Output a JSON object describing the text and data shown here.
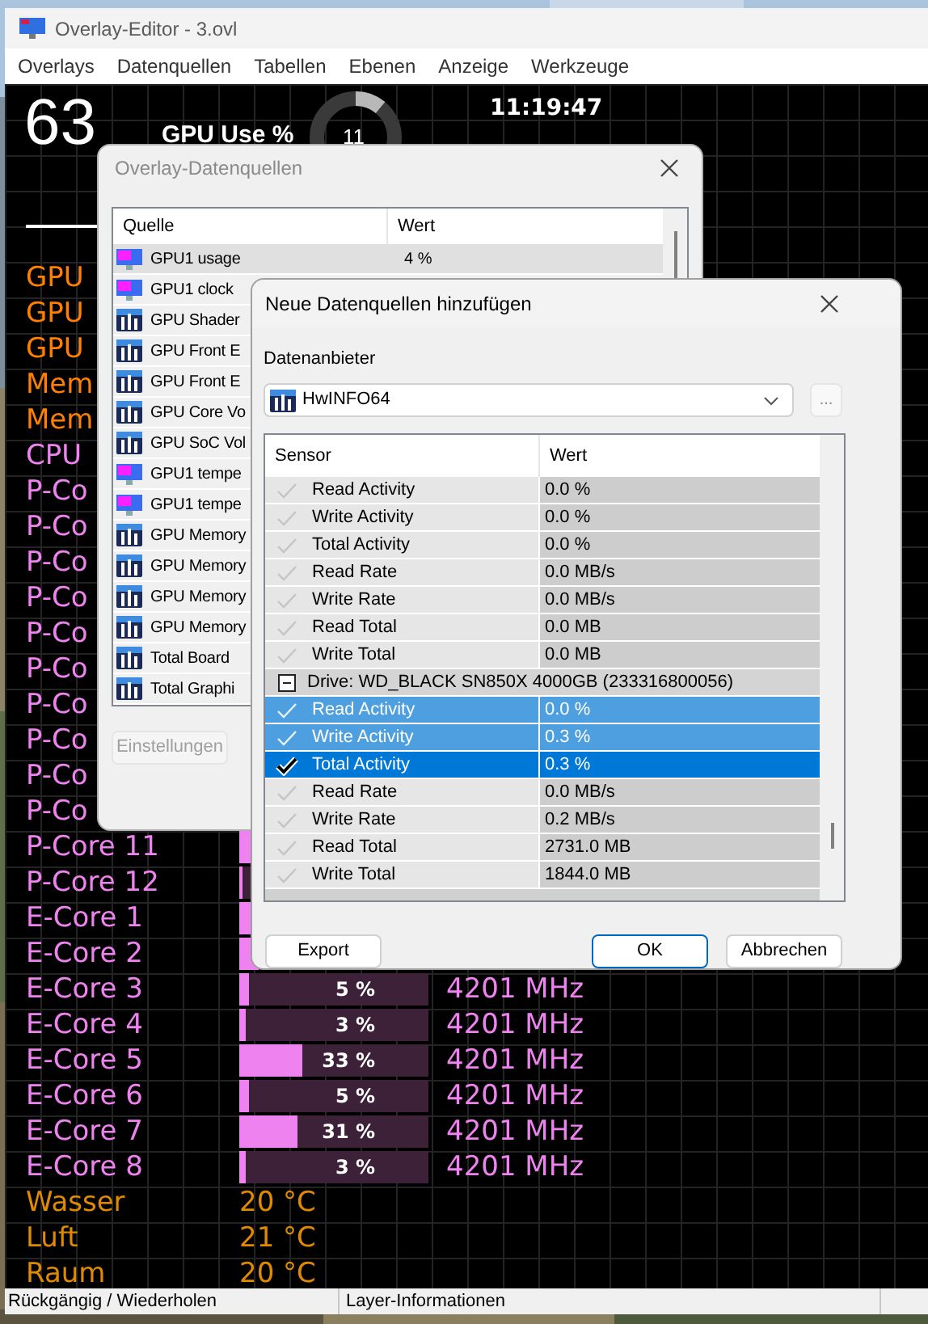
{
  "window": {
    "title": "Overlay-Editor - 3.ovl"
  },
  "menu": [
    "Overlays",
    "Datenquellen",
    "Tabellen",
    "Ebenen",
    "Anzeige",
    "Werkzeuge"
  ],
  "overlay": {
    "big_number": "63",
    "gpu_label": "GPU Use %",
    "gauge": {
      "value": "11",
      "level": 0.11
    },
    "clock": "11:19:47",
    "rows": [
      {
        "kind": "label",
        "label": "GPU",
        "color": "#ff8000"
      },
      {
        "kind": "label",
        "label": "GPU",
        "color": "#ff8000"
      },
      {
        "kind": "label",
        "label": "GPU",
        "color": "#ff8000"
      },
      {
        "kind": "label",
        "label": "Mem",
        "color": "#ff8000"
      },
      {
        "kind": "label",
        "label": "Mem",
        "color": "#ff8000"
      },
      {
        "kind": "label",
        "label": "CPU",
        "color": "#ee82ee"
      },
      {
        "kind": "label",
        "label": "P-Co",
        "color": "#ee82ee"
      },
      {
        "kind": "label",
        "label": "P-Co",
        "color": "#ee82ee"
      },
      {
        "kind": "label",
        "label": "P-Co",
        "color": "#ee82ee"
      },
      {
        "kind": "label",
        "label": "P-Co",
        "color": "#ee82ee"
      },
      {
        "kind": "label",
        "label": "P-Co",
        "color": "#ee82ee"
      },
      {
        "kind": "label",
        "label": "P-Co",
        "color": "#ee82ee"
      },
      {
        "kind": "label",
        "label": "P-Co",
        "color": "#ee82ee"
      },
      {
        "kind": "label",
        "label": "P-Co",
        "color": "#ee82ee"
      },
      {
        "kind": "label",
        "label": "P-Co",
        "color": "#ee82ee"
      },
      {
        "kind": "label",
        "label": "P-Co",
        "color": "#ee82ee"
      },
      {
        "kind": "bar",
        "label": "P-Core 11",
        "color": "#ee82ee",
        "level": 0.1
      },
      {
        "kind": "bar",
        "label": "P-Core 12",
        "color": "#ee82ee",
        "level": 0.02
      },
      {
        "kind": "bar",
        "label": "E-Core 1",
        "color": "#ee82ee",
        "level": 0.1
      },
      {
        "kind": "bar",
        "label": "E-Core 2",
        "color": "#ee82ee",
        "level": 0.1
      },
      {
        "kind": "bar",
        "label": "E-Core 3",
        "color": "#ee82ee",
        "level": 0.05,
        "value": "5 %",
        "frequency": "4201 MHz"
      },
      {
        "kind": "bar",
        "label": "E-Core 4",
        "color": "#ee82ee",
        "level": 0.03,
        "value": "3 %",
        "frequency": "4201 MHz"
      },
      {
        "kind": "bar",
        "label": "E-Core 5",
        "color": "#ee82ee",
        "level": 0.33,
        "value": "33 %",
        "frequency": "4201 MHz"
      },
      {
        "kind": "bar",
        "label": "E-Core 6",
        "color": "#ee82ee",
        "level": 0.05,
        "value": "5 %",
        "frequency": "4201 MHz"
      },
      {
        "kind": "bar",
        "label": "E-Core 7",
        "color": "#ee82ee",
        "level": 0.31,
        "value": "31 %",
        "frequency": "4201 MHz"
      },
      {
        "kind": "bar",
        "label": "E-Core 8",
        "color": "#ee82ee",
        "level": 0.03,
        "value": "3 %",
        "frequency": "4201 MHz"
      },
      {
        "kind": "reading",
        "label": "Wasser",
        "color": "#e08a00",
        "value": "20 °C"
      },
      {
        "kind": "reading",
        "label": "Luft",
        "color": "#e08a00",
        "value": "21 °C"
      },
      {
        "kind": "reading",
        "label": "Raum",
        "color": "#e08a00",
        "value": "20 °C"
      }
    ]
  },
  "sources_dialog": {
    "title": "Overlay-Datenquellen",
    "columns": [
      "Quelle",
      "Wert"
    ],
    "rows": [
      {
        "kind": "monitor",
        "name": "GPU1 usage",
        "value": "4 %",
        "selected": true
      },
      {
        "kind": "monitor",
        "name": "GPU1 clock",
        "selected": false
      },
      {
        "kind": "bars",
        "name": "GPU Shader",
        "selected": false
      },
      {
        "kind": "bars",
        "name": "GPU Front E",
        "selected": false
      },
      {
        "kind": "bars",
        "name": "GPU Front E",
        "selected": false
      },
      {
        "kind": "bars",
        "name": "GPU Core Vo",
        "selected": false
      },
      {
        "kind": "bars",
        "name": "GPU SoC Vol",
        "selected": false
      },
      {
        "kind": "monitor",
        "name": "GPU1 tempe",
        "selected": false
      },
      {
        "kind": "monitor",
        "name": "GPU1 tempe",
        "selected": false
      },
      {
        "kind": "bars",
        "name": "GPU Memory",
        "selected": false
      },
      {
        "kind": "bars",
        "name": "GPU Memory",
        "selected": false
      },
      {
        "kind": "bars",
        "name": "GPU Memory",
        "selected": false
      },
      {
        "kind": "bars",
        "name": "GPU Memory",
        "selected": false
      },
      {
        "kind": "bars",
        "name": "Total Board",
        "selected": false
      },
      {
        "kind": "bars",
        "name": "Total Graphi",
        "selected": false
      }
    ],
    "settings_button": {
      "label": "Einstellungen",
      "disabled": true
    }
  },
  "add_dialog": {
    "title": "Neue Datenquellen hinzufügen",
    "provider_label": "Datenanbieter",
    "provider": "HwINFO64",
    "more_button": "...",
    "columns": [
      "Sensor",
      "Wert"
    ],
    "rows": [
      {
        "kind": "sensor",
        "name": "Read Activity",
        "value": "0.0 %",
        "checked": false,
        "selected": false,
        "focused": false
      },
      {
        "kind": "sensor",
        "name": "Write Activity",
        "value": "0.0 %",
        "checked": false,
        "selected": false,
        "focused": false
      },
      {
        "kind": "sensor",
        "name": "Total Activity",
        "value": "0.0 %",
        "checked": false,
        "selected": false,
        "focused": false
      },
      {
        "kind": "sensor",
        "name": "Read Rate",
        "value": "0.0 MB/s",
        "checked": false,
        "selected": false,
        "focused": false
      },
      {
        "kind": "sensor",
        "name": "Write Rate",
        "value": "0.0 MB/s",
        "checked": false,
        "selected": false,
        "focused": false
      },
      {
        "kind": "sensor",
        "name": "Read Total",
        "value": "0.0 MB",
        "checked": false,
        "selected": false,
        "focused": false
      },
      {
        "kind": "sensor",
        "name": "Write Total",
        "value": "0.0 MB",
        "checked": false,
        "selected": false,
        "focused": false
      },
      {
        "kind": "group",
        "name": "Drive: WD_BLACK SN850X 4000GB (233316800056)",
        "expanded": true
      },
      {
        "kind": "sensor",
        "name": "Read Activity",
        "value": "0.0 %",
        "checked": false,
        "selected": true,
        "focused": false
      },
      {
        "kind": "sensor",
        "name": "Write Activity",
        "value": "0.3 %",
        "checked": false,
        "selected": true,
        "focused": false
      },
      {
        "kind": "sensor",
        "name": "Total Activity",
        "value": "0.3 %",
        "checked": true,
        "selected": true,
        "focused": true
      },
      {
        "kind": "sensor",
        "name": "Read Rate",
        "value": "0.0 MB/s",
        "checked": false,
        "selected": false,
        "focused": false
      },
      {
        "kind": "sensor",
        "name": "Write Rate",
        "value": "0.2 MB/s",
        "checked": false,
        "selected": false,
        "focused": false
      },
      {
        "kind": "sensor",
        "name": "Read Total",
        "value": "2731.0 MB",
        "checked": false,
        "selected": false,
        "focused": false
      },
      {
        "kind": "sensor",
        "name": "Write Total",
        "value": "1844.0 MB",
        "checked": false,
        "selected": false,
        "focused": false
      }
    ],
    "buttons": [
      "Export",
      "OK",
      "Abbrechen"
    ]
  },
  "status_bar": [
    "Rückgängig / Wiederholen",
    "Layer-Informationen"
  ]
}
